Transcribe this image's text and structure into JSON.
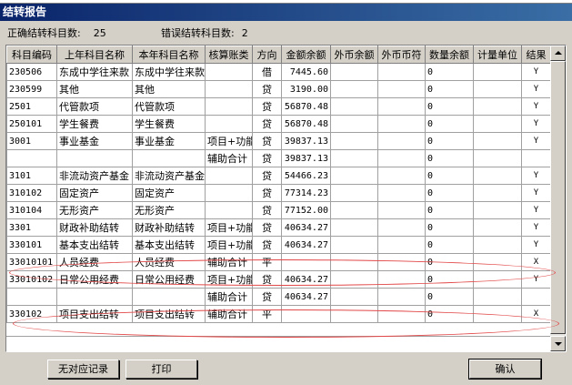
{
  "window": {
    "title": "结转报告"
  },
  "summary": {
    "correct_label": "正确结转科目数:",
    "correct_value": "25",
    "error_label": "错误结转科目数:",
    "error_value": "2"
  },
  "table": {
    "columns": [
      "科目编码",
      "上年科目名称",
      "本年科目名称",
      "核算账类",
      "方向",
      "金额余额",
      "外币余额",
      "外币币符",
      "数量余额",
      "计量单位",
      "结果"
    ],
    "rows": [
      [
        "230506",
        "东成中学往来款",
        "东成中学往来款",
        "",
        "借",
        "7445.60",
        "",
        "",
        "0",
        "",
        "Y"
      ],
      [
        "230599",
        "其他",
        "其他",
        "",
        "贷",
        "3190.00",
        "",
        "",
        "0",
        "",
        "Y"
      ],
      [
        "2501",
        "代管款项",
        "代管款项",
        "",
        "贷",
        "56870.48",
        "",
        "",
        "0",
        "",
        "Y"
      ],
      [
        "250101",
        "学生餐费",
        "学生餐费",
        "",
        "贷",
        "56870.48",
        "",
        "",
        "0",
        "",
        "Y"
      ],
      [
        "3001",
        "事业基金",
        "事业基金",
        "项目+功能",
        "贷",
        "39837.13",
        "",
        "",
        "0",
        "",
        "Y"
      ],
      [
        "",
        "",
        "",
        "辅助合计",
        "贷",
        "39837.13",
        "",
        "",
        "0",
        "",
        ""
      ],
      [
        "3101",
        "非流动资产基金",
        "非流动资产基金",
        "",
        "贷",
        "54466.23",
        "",
        "",
        "0",
        "",
        "Y"
      ],
      [
        "310102",
        "固定资产",
        "固定资产",
        "",
        "贷",
        "77314.23",
        "",
        "",
        "0",
        "",
        "Y"
      ],
      [
        "310104",
        "无形资产",
        "无形资产",
        "",
        "贷",
        "77152.00",
        "",
        "",
        "0",
        "",
        "Y"
      ],
      [
        "3301",
        "财政补助结转",
        "财政补助结转",
        "项目+功能",
        "贷",
        "40634.27",
        "",
        "",
        "0",
        "",
        "Y"
      ],
      [
        "330101",
        "基本支出结转",
        "基本支出结转",
        "项目+功能",
        "贷",
        "40634.27",
        "",
        "",
        "0",
        "",
        "Y"
      ],
      [
        "33010101",
        "人员经费",
        "人员经费",
        "辅助合计",
        "平",
        "",
        "",
        "",
        "0",
        "",
        "X"
      ],
      [
        "33010102",
        "日常公用经费",
        "日常公用经费",
        "项目+功能",
        "贷",
        "40634.27",
        "",
        "",
        "0",
        "",
        "Y"
      ],
      [
        "",
        "",
        "",
        "辅助合计",
        "贷",
        "40634.27",
        "",
        "",
        "0",
        "",
        ""
      ],
      [
        "330102",
        "项目支出结转",
        "项目支出结转",
        "辅助合计",
        "平",
        "",
        "",
        "",
        "0",
        "",
        "X"
      ]
    ]
  },
  "buttons": {
    "no_match": "无对应记录",
    "print": "打印",
    "confirm": "确认"
  },
  "colors": {
    "annotation": "#e24848",
    "titlebar": "#0a246a"
  }
}
